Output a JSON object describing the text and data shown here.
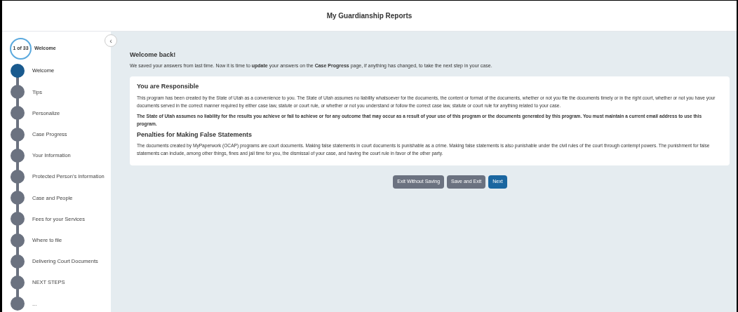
{
  "header": {
    "title": "My Guardianship Reports"
  },
  "progress": {
    "counter": "1 of 33",
    "current": "Welcome"
  },
  "collapse_button": {
    "icon": "‹"
  },
  "steps": [
    {
      "label": "Welcome",
      "selected": true
    },
    {
      "label": "Tips",
      "selected": false
    },
    {
      "label": "Personalize",
      "selected": false
    },
    {
      "label": "Case Progress",
      "selected": false
    },
    {
      "label": "Your Information",
      "selected": false
    },
    {
      "label": "Protected Person's Information",
      "selected": false
    },
    {
      "label": "Case and People",
      "selected": false
    },
    {
      "label": "Fees for your Services",
      "selected": false
    },
    {
      "label": "Where to file",
      "selected": false
    },
    {
      "label": "Delivering Court Documents",
      "selected": false
    },
    {
      "label": "NEXT STEPS",
      "selected": false
    },
    {
      "label": "...",
      "selected": false
    }
  ],
  "welcome": {
    "heading": "Welcome back!",
    "text": "We saved your answers from last time. Now it is time to **update** your answers on the **Case Progress** page, if anything has changed, to take the next step in your case."
  },
  "notice": {
    "sections": [
      {
        "heading": "You are Responsible",
        "paragraphs": [
          {
            "text": "This program has been created by the State of Utah as a convenience to you. The State of Utah assumes no liability whatsoever for the documents, the content or format of the documents, whether or not you file the documents timely or in the right court, whether or not you have your documents served in the correct manner required by either case law, statute or court rule, or whether or not you understand or follow the correct case law, statute or court rule for anything related to your case.",
            "bold": false
          },
          {
            "text": "The State of Utah assumes no liability for the results you achieve or fail to achieve or for any outcome that may occur as a result of your use of this program or the documents generated by this program. You must maintain a current email address to use this program.",
            "bold": true
          }
        ]
      },
      {
        "heading": "Penalties for Making False Statements",
        "paragraphs": [
          {
            "text": "The documents created by MyPaperwork (OCAP) programs are court documents. Making false statements in court documents is punishable as a crime. Making false statements is also punishable under the civil rules of the court through contempt powers. The punishment for false statements can include, among other things, fines and jail time for you, the dismissal of your case, and having the court rule in favor of the other party.",
            "bold": false
          }
        ]
      }
    ]
  },
  "buttons": [
    {
      "label": "Exit Without Saving",
      "kind": "secondary"
    },
    {
      "label": "Save and Exit",
      "kind": "secondary"
    },
    {
      "label": "Next",
      "kind": "primary"
    }
  ]
}
